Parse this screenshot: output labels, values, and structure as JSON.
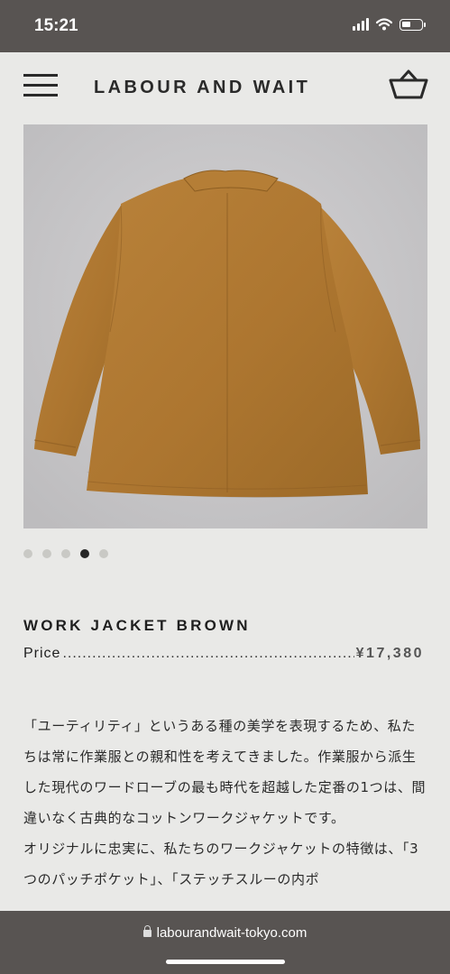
{
  "status_bar": {
    "time": "15:21"
  },
  "header": {
    "brand": "LABOUR AND WAIT"
  },
  "gallery": {
    "image_count": 5,
    "active_index": 4
  },
  "product": {
    "title": "WORK JACKET BROWN",
    "price_label": "Price",
    "price_leader": "..............................................................................",
    "price": "¥17,380"
  },
  "description": {
    "paragraph1": "「ユーティリティ」というある種の美学を表現するため、私たちは常に作業服との親和性を考えてきました。作業服から派生した現代のワードローブの最も時代を超越した定番の1つは、間違いなく古典的なコットンワークジャケットです。",
    "paragraph2": "オリジナルに忠実に、私たちのワークジャケットの特徴は、「3つのパッチポケット」、「ステッチスルーの内ポ"
  },
  "browser": {
    "url": "labourandwait-tokyo.com"
  },
  "colors": {
    "bars": "#585452",
    "page": "#e9e9e7",
    "jacket": "#b27a30",
    "photo_bg": "#c9c8ca"
  },
  "icons": [
    "menu-icon",
    "basket-icon",
    "lock-icon",
    "signal-icon",
    "wifi-icon",
    "battery-icon"
  ]
}
